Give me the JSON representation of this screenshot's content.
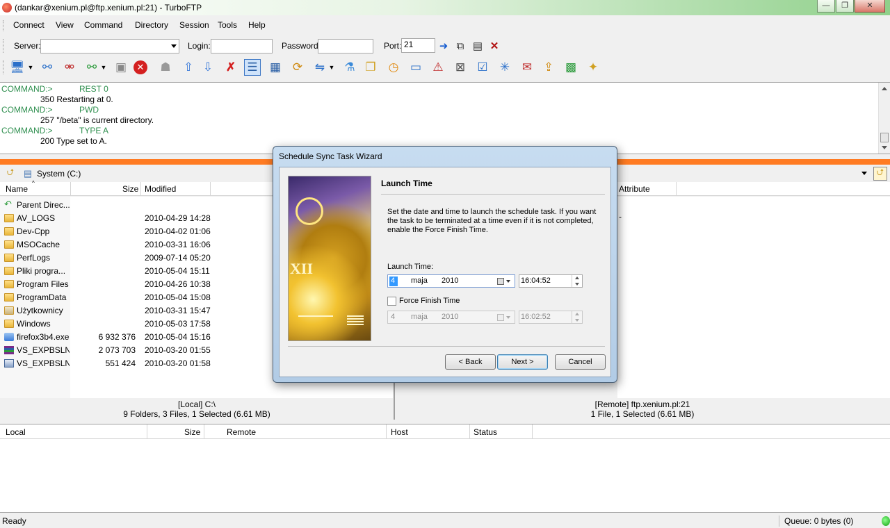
{
  "window": {
    "title": "(dankar@xenium.pl@ftp.xenium.pl:21) - TurboFTP",
    "minimize_glyph": "—",
    "restore_glyph": "❐",
    "close_glyph": "✕"
  },
  "menu": [
    "Connect",
    "View",
    "Command",
    "Directory",
    "Session",
    "Tools",
    "Help"
  ],
  "connection": {
    "server_label": "Server:",
    "server_value": "",
    "login_label": "Login:",
    "login_value": "",
    "password_label": "Password:",
    "password_value": "",
    "port_label": "Port:",
    "port_value": "21"
  },
  "log": [
    {
      "prefix": "COMMAND:>",
      "text": "REST 0",
      "type": "command"
    },
    {
      "prefix": "",
      "text": "350 Restarting at 0.",
      "type": "reply"
    },
    {
      "prefix": "COMMAND:>",
      "text": "PWD",
      "type": "command"
    },
    {
      "prefix": "",
      "text": "257 \"/beta\" is current directory.",
      "type": "reply"
    },
    {
      "prefix": "COMMAND:>",
      "text": "TYPE A",
      "type": "command"
    },
    {
      "prefix": "",
      "text": "200 Type set to A.",
      "type": "reply"
    }
  ],
  "local": {
    "path": "System (C:)",
    "columns": {
      "name": "Name",
      "size": "Size",
      "modified": "Modified"
    },
    "files": [
      {
        "name": "Parent Direc...",
        "size": "",
        "modified": "",
        "icon": "parent-dir-icon"
      },
      {
        "name": "AV_LOGS",
        "size": "",
        "modified": "2010-04-29 14:28",
        "icon": "folder-icon"
      },
      {
        "name": "Dev-Cpp",
        "size": "",
        "modified": "2010-04-02 01:06",
        "icon": "folder-icon"
      },
      {
        "name": "MSOCache",
        "size": "",
        "modified": "2010-03-31 16:06",
        "icon": "folder-icon"
      },
      {
        "name": "PerfLogs",
        "size": "",
        "modified": "2009-07-14 05:20",
        "icon": "folder-icon"
      },
      {
        "name": "Pliki progra...",
        "size": "",
        "modified": "2010-05-04 15:11",
        "icon": "folder-icon"
      },
      {
        "name": "Program Files",
        "size": "",
        "modified": "2010-04-26 10:38",
        "icon": "folder-icon"
      },
      {
        "name": "ProgramData",
        "size": "",
        "modified": "2010-05-04 15:08",
        "icon": "folder-icon"
      },
      {
        "name": "Użytkownicy",
        "size": "",
        "modified": "2010-03-31 15:47",
        "icon": "folder-icon"
      },
      {
        "name": "Windows",
        "size": "",
        "modified": "2010-05-03 17:58",
        "icon": "folder-icon"
      },
      {
        "name": "firefox3b4.exe",
        "size": "6 932 376",
        "modified": "2010-05-04 15:16",
        "icon": "exe-icon"
      },
      {
        "name": "VS_EXPBSLN...",
        "size": "2 073 703",
        "modified": "2010-03-20 01:55",
        "icon": "archive-icon"
      },
      {
        "name": "VS_EXPBSLN...",
        "size": "551 424",
        "modified": "2010-03-20 01:58",
        "icon": "installer-icon"
      }
    ],
    "status_line1": "[Local] C:\\",
    "status_line2": "9 Folders, 3 Files, 1 Selected (6.61 MB)"
  },
  "remote": {
    "attribute_header": "Attribute",
    "status_line1": "[Remote] ftp.xenium.pl:21",
    "status_line2": "1 File, 1 Selected (6.61 MB)"
  },
  "queue": {
    "columns": [
      "Local",
      "Size",
      "Remote",
      "Host",
      "Status"
    ]
  },
  "statusbar": {
    "left": "Ready",
    "queue": "Queue: 0 bytes  (0)"
  },
  "dialog": {
    "title": "Schedule Sync Task Wizard",
    "heading": "Launch Time",
    "description": "Set the date and time to launch the schedule task.  If you want the task to be terminated at a time even if it is not completed, enable the Force Finish Time.",
    "launch_label": "Launch Time:",
    "launch_day": "4",
    "launch_month": "maja",
    "launch_year": "2010",
    "launch_time": "16:04:52",
    "force_label": "Force Finish Time",
    "force_checked": false,
    "force_day": "4",
    "force_month": "maja",
    "force_year": "2010",
    "force_time": "16:02:52",
    "back_label": "< Back",
    "next_label": "Next >",
    "cancel_label": "Cancel"
  },
  "colors": {
    "accent_splitter": "#ff7b22",
    "log_command": "#2f8f4f",
    "selection": "#3399ff"
  }
}
